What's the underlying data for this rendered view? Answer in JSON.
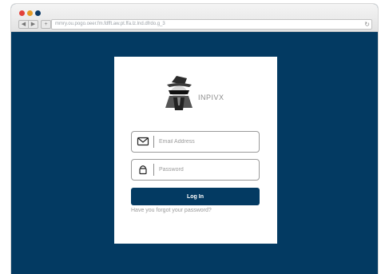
{
  "browser": {
    "url": "mmry.ou.pogo.oeer.fm.fdfft.aw.pt.ffa.lz.lnd.dfrdo.g_3",
    "back_icon": "back-arrow-icon",
    "forward_icon": "forward-arrow-icon",
    "new_tab_icon": "plus-icon",
    "reload_icon": "reload-icon",
    "back_glyph": "◀",
    "forward_glyph": "▶",
    "plus_glyph": "+",
    "reload_glyph": "↻"
  },
  "brand": {
    "name": "INPIVX",
    "logo_icon": "spy-hat-logo-icon"
  },
  "login": {
    "email_placeholder": "Email Address",
    "email_icon": "envelope-icon",
    "password_placeholder": "Password",
    "password_icon": "lock-icon",
    "login_label": "Log In",
    "forgot_label": "Have you forgot your password?"
  },
  "colors": {
    "background": "#033a62",
    "button": "#033a62",
    "card": "#ffffff",
    "window_close": "#e2413a",
    "window_minimize": "#e59a25",
    "window_zoom": "#0c3a66"
  }
}
